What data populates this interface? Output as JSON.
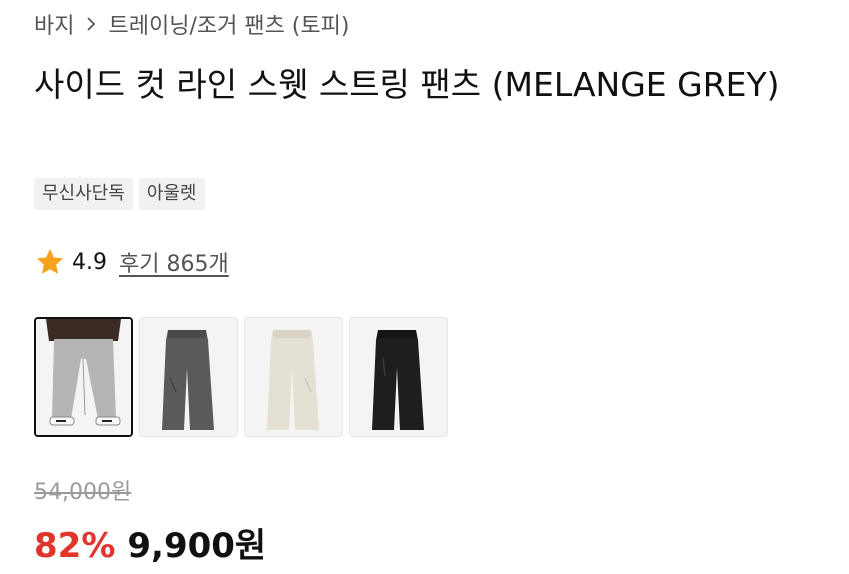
{
  "breadcrumb": {
    "parent": "바지",
    "current": "트레이닝/조거 팬츠 (토피)"
  },
  "product": {
    "title": "사이드 컷 라인 스웻 스트링 팬츠 (MELANGE GREY)"
  },
  "tags": [
    "무신사단독",
    "아울렛"
  ],
  "rating": {
    "score": "4.9",
    "reviews": "후기 865개",
    "star_color": "#f7a21b"
  },
  "thumbnails": [
    {
      "name": "model-wearing-grey",
      "color": "#b8b8b8",
      "active": true
    },
    {
      "name": "charcoal-flat",
      "color": "#5a5a5a",
      "active": false
    },
    {
      "name": "ivory-flat",
      "color": "#e6e2d7",
      "active": false
    },
    {
      "name": "black-flat",
      "color": "#1e1e1e",
      "active": false
    }
  ],
  "price": {
    "original": "54,000원",
    "discount": "82%",
    "sale": "9,900원",
    "discount_color": "#e0352b"
  }
}
